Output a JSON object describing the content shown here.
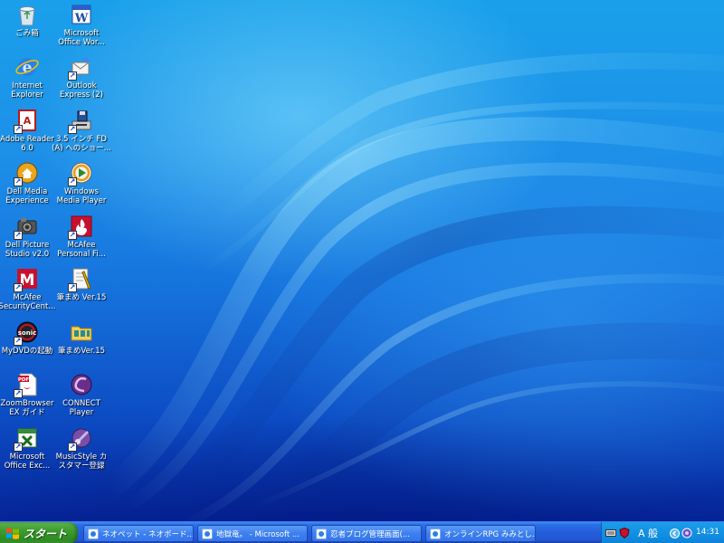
{
  "desktop": {
    "icons": [
      {
        "label": "ごみ箱",
        "icon": "recycle-bin-icon",
        "shortcut": false
      },
      {
        "label": "Internet\nExplorer",
        "icon": "internet-explorer-icon",
        "shortcut": false
      },
      {
        "label": "Adobe Reader\n6.0",
        "icon": "adobe-reader-icon",
        "shortcut": true
      },
      {
        "label": "Dell Media\nExperience",
        "icon": "dell-media-icon",
        "shortcut": true
      },
      {
        "label": "Dell Picture\nStudio v2.0",
        "icon": "dell-picture-studio-icon",
        "shortcut": true
      },
      {
        "label": "McAfee\nSecurityCent...",
        "icon": "mcafee-securitycenter-icon",
        "shortcut": true
      },
      {
        "label": "MyDVDの起動",
        "icon": "mydvd-icon",
        "shortcut": true
      },
      {
        "label": "ZoomBrowser\nEX ガイド",
        "icon": "pdf-document-icon",
        "shortcut": true
      },
      {
        "label": "Microsoft\nOffice Exc...",
        "icon": "excel-icon",
        "shortcut": true
      },
      {
        "label": "Microsoft\nOffice Wor...",
        "icon": "word-icon",
        "shortcut": false
      },
      {
        "label": "Outlook\nExpress (2)",
        "icon": "outlook-express-icon",
        "shortcut": true
      },
      {
        "label": "3.5 インチ FD\n(A) へのショー...",
        "icon": "floppy-drive-icon",
        "shortcut": true
      },
      {
        "label": "Windows\nMedia Player",
        "icon": "windows-media-player-icon",
        "shortcut": true
      },
      {
        "label": "McAfee\nPersonal Fi...",
        "icon": "mcafee-firewall-icon",
        "shortcut": true
      },
      {
        "label": "筆まめ Ver.15",
        "icon": "fudemame-icon",
        "shortcut": true
      },
      {
        "label": "筆まめVer.15",
        "icon": "folder-icon",
        "shortcut": false
      },
      {
        "label": "CONNECT\nPlayer",
        "icon": "connect-player-icon",
        "shortcut": false
      },
      {
        "label": "MusicStyle カ\nスタマー登録",
        "icon": "musicstyle-icon",
        "shortcut": true
      }
    ]
  },
  "taskbar": {
    "start_label": "スタート",
    "tasks": [
      {
        "label": "ネオペット - ネオボード..."
      },
      {
        "label": "地獄竜。 - Microsoft ..."
      },
      {
        "label": "忍者ブログ管理画面(..."
      },
      {
        "label": "オンラインRPG みみとし..."
      }
    ],
    "tray": {
      "ime": "A 般",
      "clock": "14:31"
    }
  },
  "colors": {
    "taskbar_blue": "#245edb",
    "start_green": "#3c9b2e",
    "tray_blue": "#1290e3"
  }
}
